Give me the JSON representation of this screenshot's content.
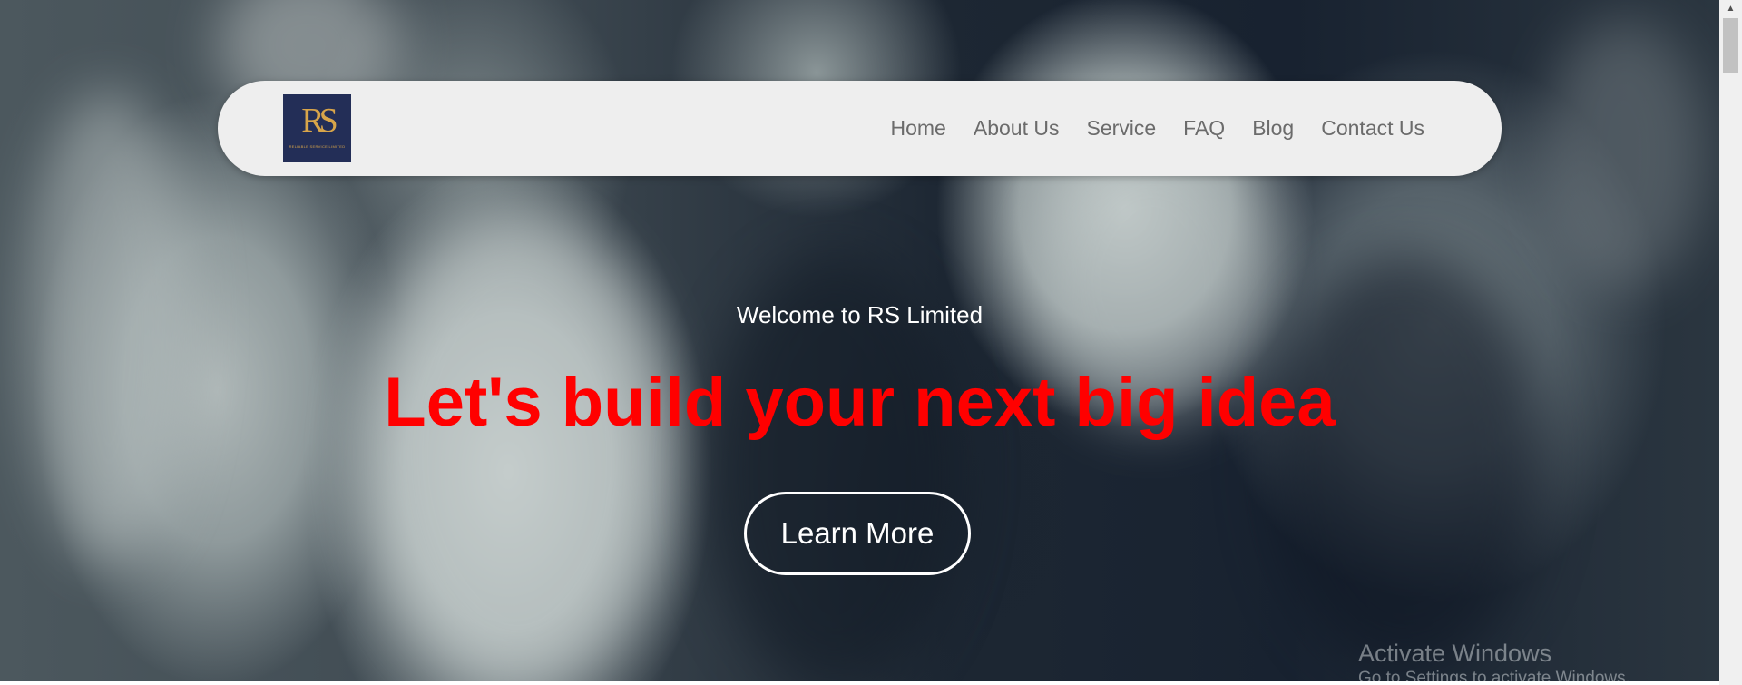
{
  "brand": {
    "logo_mark": "RS",
    "logo_sub": "RELIABLE SERVICE LIMITED",
    "logo_bg": "#232e57",
    "logo_accent": "#d8a54a"
  },
  "nav": {
    "items": [
      {
        "label": "Home"
      },
      {
        "label": "About Us"
      },
      {
        "label": "Service"
      },
      {
        "label": "FAQ"
      },
      {
        "label": "Blog"
      },
      {
        "label": "Contact Us"
      }
    ]
  },
  "hero": {
    "welcome": "Welcome to RS Limited",
    "headline": "Let's build your next big idea",
    "headline_color": "#ff0000",
    "cta_label": "Learn More"
  },
  "os_overlay": {
    "title": "Activate Windows",
    "subtitle": "Go to Settings to activate Windows."
  },
  "scrollbar": {
    "up_arrow_icon": "▲"
  }
}
